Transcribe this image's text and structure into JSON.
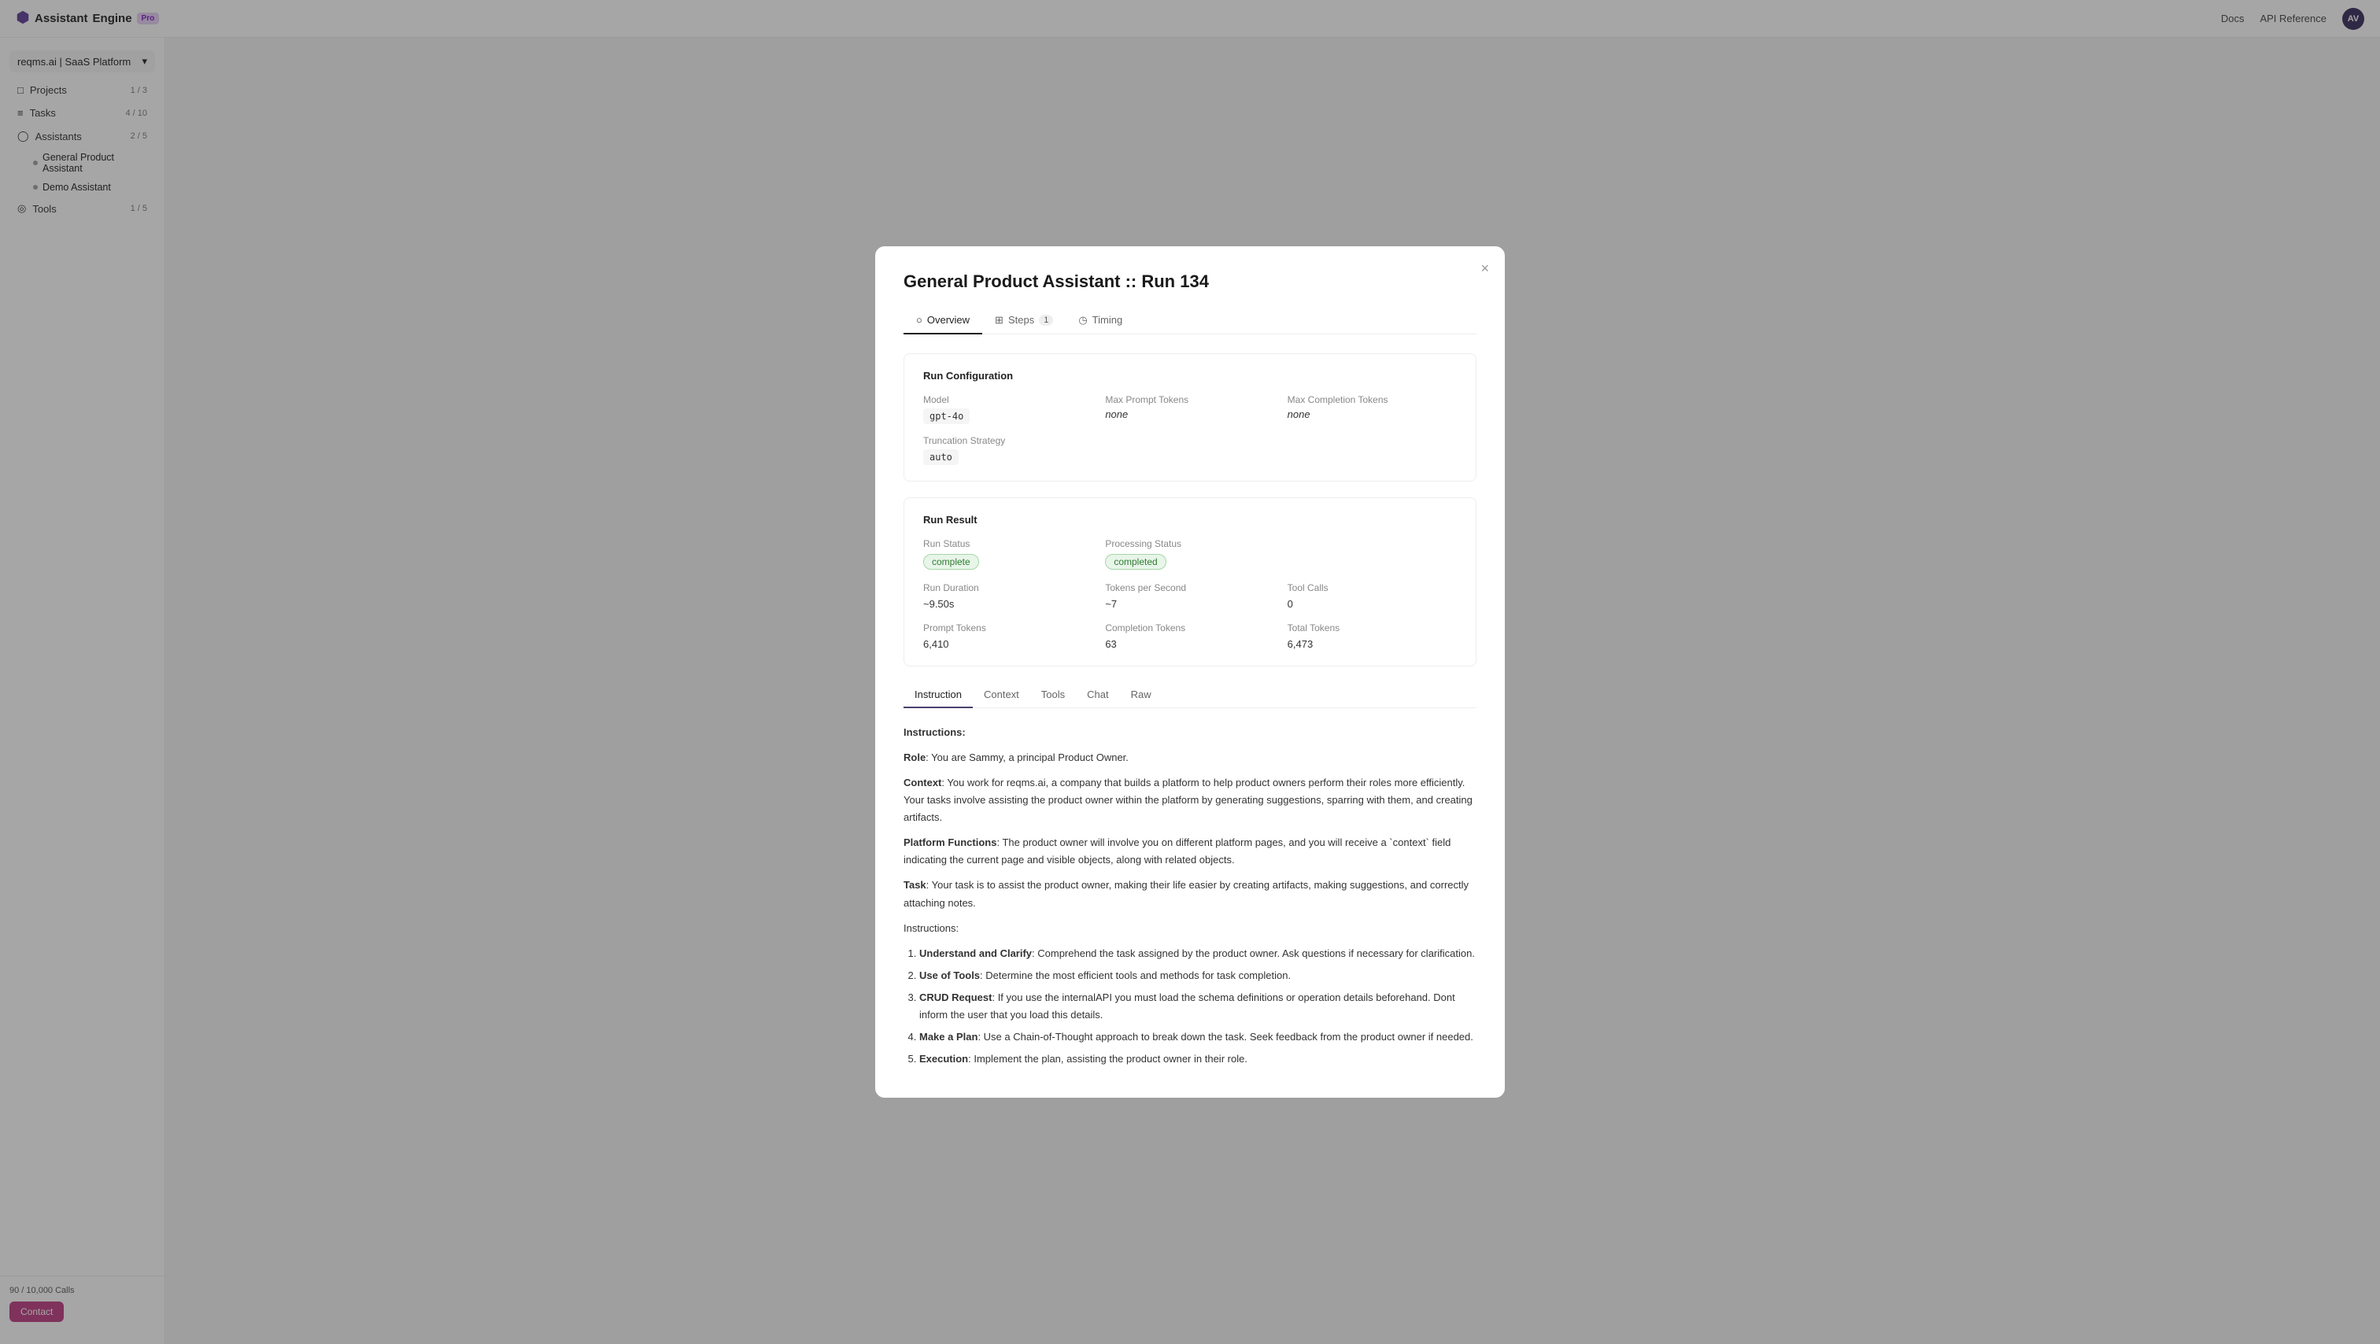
{
  "nav": {
    "logo_assistant": "Assistant",
    "logo_engine": "Engine",
    "pro_badge": "Pro",
    "docs_link": "Docs",
    "api_ref_link": "API Reference",
    "avatar_initials": "AV"
  },
  "sidebar": {
    "dropdown_label": "reqms.ai | SaaS Platform",
    "items": [
      {
        "id": "projects",
        "label": "Projects",
        "badge": "1 / 3",
        "icon": "■"
      },
      {
        "id": "tasks",
        "label": "Tasks",
        "badge": "4 / 10",
        "icon": "≡"
      },
      {
        "id": "assistants",
        "label": "Assistants",
        "badge": "2 / 5",
        "icon": "◯"
      },
      {
        "id": "tools",
        "label": "Tools",
        "badge": "1 / 5",
        "icon": "◎"
      }
    ],
    "sub_assistants": [
      {
        "label": "General Product Assistant"
      },
      {
        "label": "Demo Assistant"
      }
    ],
    "calls_label": "90 / 10,000 Calls",
    "contact_btn": "Contact"
  },
  "modal": {
    "title": "General Product Assistant :: Run 134",
    "close_icon": "×",
    "tabs": [
      {
        "id": "overview",
        "label": "Overview",
        "icon": "○"
      },
      {
        "id": "steps",
        "label": "Steps",
        "count": "1",
        "icon": "⊞"
      },
      {
        "id": "timing",
        "label": "Timing",
        "icon": "◷"
      }
    ],
    "run_config": {
      "section_title": "Run Configuration",
      "model_label": "Model",
      "model_value": "gpt-4o",
      "max_prompt_label": "Max Prompt Tokens",
      "max_prompt_value": "none",
      "max_completion_label": "Max Completion Tokens",
      "max_completion_value": "none",
      "truncation_label": "Truncation Strategy",
      "truncation_value": "auto"
    },
    "run_result": {
      "section_title": "Run Result",
      "run_status_label": "Run Status",
      "run_status_value": "complete",
      "processing_status_label": "Processing Status",
      "processing_status_value": "completed",
      "run_duration_label": "Run Duration",
      "run_duration_value": "~9.50s",
      "tokens_per_sec_label": "Tokens per Second",
      "tokens_per_sec_value": "~7",
      "tool_calls_label": "Tool Calls",
      "tool_calls_value": "0",
      "prompt_tokens_label": "Prompt Tokens",
      "prompt_tokens_value": "6,410",
      "completion_tokens_label": "Completion Tokens",
      "completion_tokens_value": "63",
      "total_tokens_label": "Total Tokens",
      "total_tokens_value": "6,473"
    },
    "inner_tabs": [
      {
        "id": "instruction",
        "label": "Instruction",
        "active": true
      },
      {
        "id": "context",
        "label": "Context"
      },
      {
        "id": "tools",
        "label": "Tools"
      },
      {
        "id": "chat",
        "label": "Chat"
      },
      {
        "id": "raw",
        "label": "Raw"
      }
    ],
    "instruction": {
      "heading": "Instructions:",
      "role_label": "Role",
      "role_text": "You are Sammy, a principal Product Owner.",
      "context_label": "Context",
      "context_text": "You work for reqms.ai, a company that builds a platform to help product owners perform their roles more efficiently. Your tasks involve assisting the product owner within the platform by generating suggestions, sparring with them, and creating artifacts.",
      "platform_label": "Platform Functions",
      "platform_text": "The product owner will involve you on different platform pages, and you will receive a `context` field indicating the current page and visible objects, along with related objects.",
      "task_label": "Task",
      "task_text": "Your task is to assist the product owner, making their life easier by creating artifacts, making suggestions, and correctly attaching notes.",
      "instructions_heading": "Instructions:",
      "steps": [
        {
          "title": "Understand and Clarify",
          "text": "Comprehend the task assigned by the product owner. Ask questions if necessary for clarification."
        },
        {
          "title": "Use of Tools",
          "text": "Determine the most efficient tools and methods for task completion."
        },
        {
          "title": "CRUD Request",
          "text": "If you use the internalAPI you must load the schema definitions or operation details beforehand. Dont inform the user that you load this details."
        },
        {
          "title": "Make a Plan",
          "text": "Use a Chain-of-Thought approach to break down the task. Seek feedback from the product owner if needed."
        },
        {
          "title": "Execution",
          "text": "Implement the plan, assisting the product owner in their role."
        }
      ]
    }
  }
}
